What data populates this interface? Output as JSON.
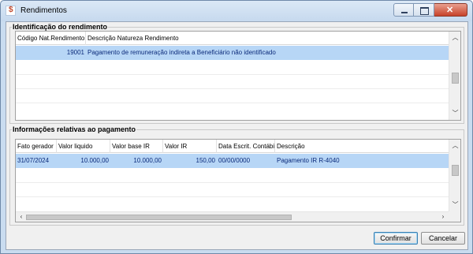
{
  "window": {
    "title": "Rendimentos"
  },
  "group1": {
    "title": "Identificação do rendimento",
    "columns": [
      "Código Nat.Rendimento",
      "Descrição Natureza Rendimento"
    ],
    "rows": [
      {
        "codigo": "19001",
        "descricao": "Pagamento de remuneração indireta a Beneficiário não identificado"
      }
    ]
  },
  "group2": {
    "title": "Informações relativas ao pagamento",
    "columns": [
      "Fato gerador",
      "Valor liquido",
      "Valor base IR",
      "Valor IR",
      "Data Escrit. Contábil",
      "Descrição"
    ],
    "rows": [
      {
        "fato_gerador": "31/07/2024",
        "valor_liquido": "10.000,00",
        "valor_base_ir": "10.000,00",
        "valor_ir": "150,00",
        "data_escrit": "00/00/0000",
        "descricao": "Pagamento IR R-4040"
      }
    ]
  },
  "buttons": {
    "confirm": "Confirmar",
    "cancel": "Cancelar"
  },
  "colors": {
    "selection": "#b7d6f6",
    "accent": "#3c7fb1",
    "close": "#c7422a"
  }
}
